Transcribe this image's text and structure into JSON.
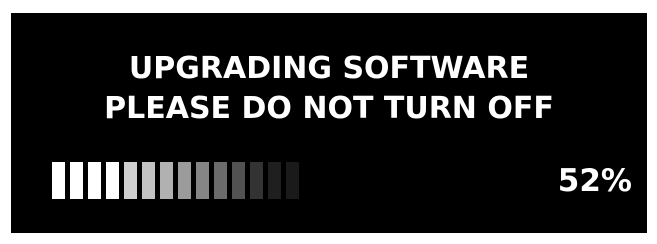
{
  "dialog": {
    "title_line1": "UPGRADING SOFTWARE",
    "title_line2": "PLEASE DO NOT TURN OFF",
    "progress_percent": "52%",
    "progress_value": 52
  },
  "colors": {
    "background": "#000000",
    "text": "#ffffff",
    "segments": [
      "#ffffff",
      "#ffffff",
      "#ffffff",
      "#ffffff",
      "#cfcfcf",
      "#c2c2c2",
      "#b1b1b1",
      "#9b9b9b",
      "#858585",
      "#6b6b6b",
      "#525252",
      "#333333",
      "#1f1f1f",
      "#1a1a1a"
    ]
  }
}
